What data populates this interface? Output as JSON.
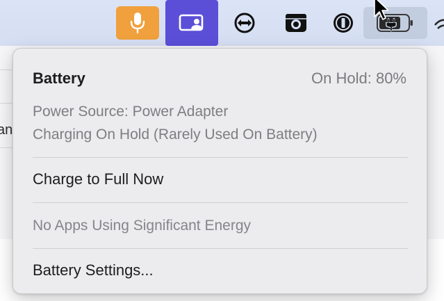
{
  "menubar": {
    "icons": [
      {
        "name": "microphone-icon",
        "color": "#f0a03c"
      },
      {
        "name": "screen-share-icon",
        "color": "#5b4fd8"
      },
      {
        "name": "teamviewer-icon"
      },
      {
        "name": "camera-icon"
      },
      {
        "name": "1password-icon"
      },
      {
        "name": "battery-charging-icon"
      }
    ]
  },
  "battery_menu": {
    "title": "Battery",
    "status": "On Hold: 80%",
    "power_source": "Power Source: Power Adapter",
    "charging_state": "Charging On Hold (Rarely Used On Battery)",
    "charge_full_label": "Charge to Full Now",
    "energy_note": "No Apps Using Significant Energy",
    "settings_label": "Battery Settings..."
  },
  "background": {
    "partial_text": "an"
  }
}
